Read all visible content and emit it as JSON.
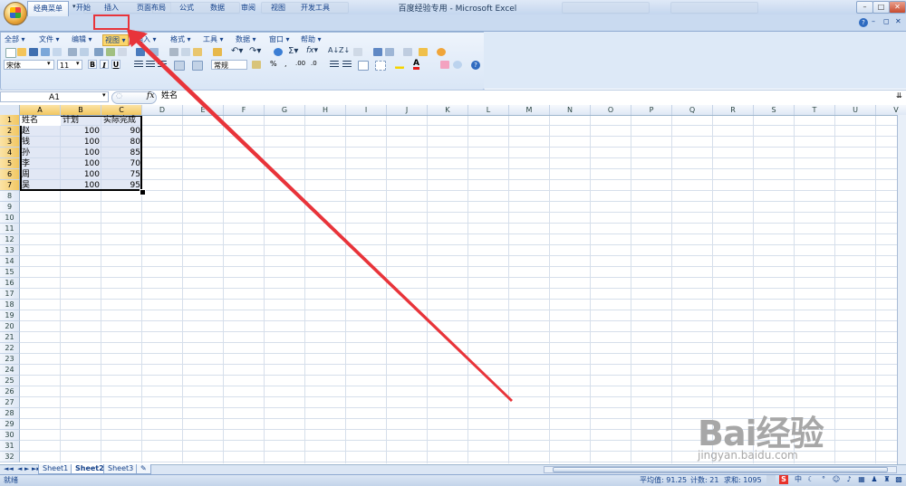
{
  "window": {
    "title": "百度经验专用 - Microsoft Excel",
    "controls": [
      "–",
      "□",
      "✕"
    ]
  },
  "ribbon_tabs": [
    {
      "label": "经典菜单",
      "active": true
    },
    {
      "label": "开始",
      "active": false
    },
    {
      "label": "插入",
      "active": false,
      "highlighted": true
    },
    {
      "label": "页面布局",
      "active": false
    },
    {
      "label": "公式",
      "active": false
    },
    {
      "label": "数据",
      "active": false
    },
    {
      "label": "审阅",
      "active": false
    },
    {
      "label": "视图",
      "active": false
    },
    {
      "label": "开发工具",
      "active": false
    }
  ],
  "classic_menu": {
    "items": [
      "全部",
      "文件",
      "编辑",
      "视图",
      "插入",
      "格式",
      "工具",
      "数据",
      "窗口",
      "帮助"
    ],
    "selected": "视图"
  },
  "toolbar": {
    "font": "宋体",
    "font_size": "11",
    "bold": "B",
    "italic": "I",
    "underline": "U",
    "number_format": "常规",
    "percent": "%"
  },
  "formula_bar": {
    "name_box": "A1",
    "fx": "fx",
    "content": "姓名"
  },
  "columns": [
    "A",
    "B",
    "C",
    "D",
    "E",
    "F",
    "G",
    "H",
    "I",
    "J",
    "K",
    "L",
    "M",
    "N",
    "O",
    "P",
    "Q",
    "R",
    "S",
    "T",
    "U",
    "V"
  ],
  "selected_columns": [
    "A",
    "B",
    "C"
  ],
  "rows": [
    "1",
    "2",
    "3",
    "4",
    "5",
    "6",
    "7",
    "8",
    "9",
    "10",
    "11",
    "12",
    "13",
    "14",
    "15",
    "16",
    "17",
    "18",
    "19",
    "20",
    "21",
    "22",
    "23",
    "24",
    "25",
    "26",
    "27",
    "28",
    "29",
    "30",
    "31",
    "32"
  ],
  "selected_rows": [
    "1",
    "2",
    "3",
    "4",
    "5",
    "6",
    "7"
  ],
  "table": {
    "headers": [
      "姓名",
      "计划",
      "实际完成"
    ],
    "rows": [
      [
        "赵",
        "100",
        "90"
      ],
      [
        "钱",
        "100",
        "80"
      ],
      [
        "孙",
        "100",
        "85"
      ],
      [
        "李",
        "100",
        "70"
      ],
      [
        "周",
        "100",
        "75"
      ],
      [
        "吴",
        "100",
        "95"
      ]
    ]
  },
  "sheets": [
    {
      "label": "Sheet1",
      "active": false
    },
    {
      "label": "Sheet2",
      "active": true
    },
    {
      "label": "Sheet3",
      "active": false
    }
  ],
  "status": {
    "ready": "就绪",
    "average": "平均值: 91.25",
    "count": "计数: 21",
    "sum": "求和: 1095"
  },
  "ime": {
    "mode": "中"
  },
  "watermark": {
    "brand": "Bai经验",
    "url": "jingyan.baidu.com"
  },
  "annotation": {
    "color": "#e8343a"
  }
}
